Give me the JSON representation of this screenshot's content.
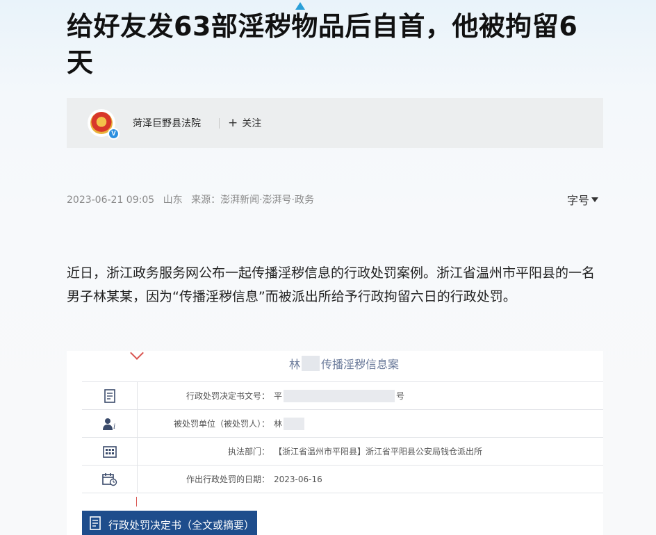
{
  "article": {
    "title": "给好友发63部淫秽物品后自首，他被拘留6天"
  },
  "author": {
    "name": "菏泽巨野县法院",
    "verified_badge": "V",
    "follow_label": "关注",
    "follow_icon": "plus-icon"
  },
  "meta": {
    "datetime": "2023-06-21 09:05",
    "location": "山东",
    "source": "来源：澎湃新闻·澎湃号·政务"
  },
  "font_control": {
    "label": "字号"
  },
  "body": {
    "paragraph_1": "近日，浙江政务服务网公布一起传播淫秽信息的行政处罚案例。浙江省温州市平阳县的一名男子林某某，因为“传播淫秽信息”而被派出所给予行政拘留六日的行政处罚。"
  },
  "document": {
    "title_prefix": "林",
    "title_suffix": "传播淫秽信息案",
    "rows": [
      {
        "icon": "document-icon",
        "label": "行政处罚决定书文号：",
        "value_prefix": "平",
        "value_suffix": "号"
      },
      {
        "icon": "person-icon",
        "label": "被处罚单位（被处罚人）：",
        "value_prefix": "林",
        "value_suffix": ""
      },
      {
        "icon": "building-icon",
        "label": "执法部门：",
        "value_prefix": "【浙江省温州市平阳县】浙江省平阳县公安局钱仓派出所",
        "value_suffix": ""
      },
      {
        "icon": "calendar-icon",
        "label": "作出行政处罚的日期：",
        "value_prefix": "2023-06-16",
        "value_suffix": ""
      }
    ],
    "tab_label": "行政处罚决定书（全文或摘要）"
  },
  "colors": {
    "accent_blue": "#2a9fd8",
    "doc_tab_bg": "#1e4d8c",
    "verified_blue": "#2b8fe0"
  }
}
